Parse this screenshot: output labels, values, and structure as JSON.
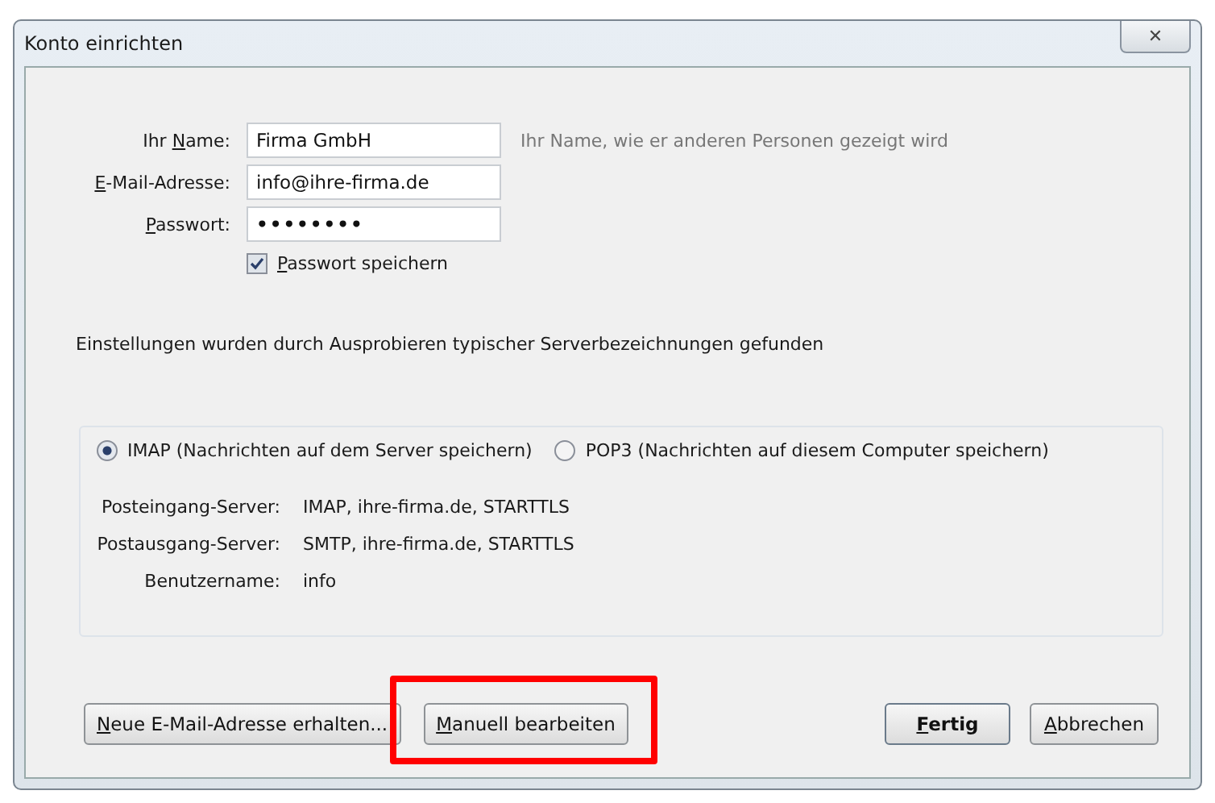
{
  "window": {
    "title": "Konto einrichten",
    "close": "✕"
  },
  "fields": [
    {
      "label": {
        "pre": "Ihr ",
        "key": "N",
        "post": "ame:"
      },
      "value": "Firma GmbH",
      "hint": "Ihr Name, wie er anderen Personen gezeigt wird",
      "kind": "text"
    },
    {
      "label": {
        "key": "E",
        "post": "-Mail-Adresse:"
      },
      "value": "info@ihre-firma.de",
      "kind": "text"
    },
    {
      "label": {
        "key": "P",
        "post": "asswort:"
      },
      "value": "••••••••",
      "kind": "password"
    }
  ],
  "remember": {
    "label": {
      "key": "P",
      "post": "asswort speichern"
    },
    "checked": true
  },
  "message": "Einstellungen wurden durch Ausprobieren typischer Serverbezeichnungen gefunden",
  "protocols": [
    {
      "label": "IMAP (Nachrichten auf dem Server speichern)",
      "selected": true
    },
    {
      "label": "POP3 (Nachrichten auf diesem Computer speichern)",
      "selected": false
    }
  ],
  "servers": [
    {
      "label": "Posteingang-Server:",
      "value": "IMAP, ihre-firma.de, STARTTLS"
    },
    {
      "label": "Postausgang-Server:",
      "value": "SMTP, ihre-firma.de, STARTTLS"
    },
    {
      "label": "Benutzername:",
      "value": "info"
    }
  ],
  "buttons_left": [
    {
      "label": {
        "key": "N",
        "post": "eue E-Mail-Adresse erhalten..."
      },
      "highlighted": false
    },
    {
      "label": {
        "key": "M",
        "post": "anuell bearbeiten"
      },
      "highlighted": true
    }
  ],
  "buttons_right": [
    {
      "label": {
        "key": "F",
        "post": "ertig"
      },
      "default": true
    },
    {
      "label": {
        "key": "A",
        "post": "bbrechen"
      },
      "default": false
    }
  ]
}
